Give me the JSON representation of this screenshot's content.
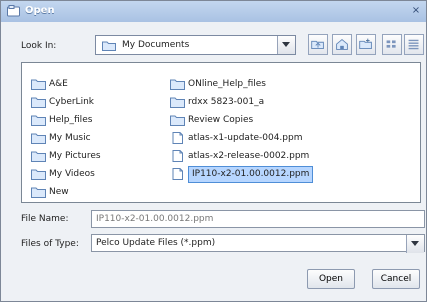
{
  "window": {
    "title": "Open",
    "close_symbol": "×"
  },
  "lookin": {
    "label": "Look In:",
    "value": "My Documents"
  },
  "toolbar": {
    "icons": [
      "up-folder-icon",
      "home-icon",
      "new-folder-icon",
      "list-view-icon",
      "details-view-icon"
    ]
  },
  "files": {
    "left": [
      "A&E",
      "CyberLink",
      "Help_files",
      "My Music",
      "My Pictures",
      "My Videos",
      "New"
    ],
    "right": [
      "ONline_Help_files",
      "rdxx 5823-001_a",
      "Review Copies",
      "atlas-x1-update-004.ppm",
      "atlas-x2-release-0002.ppm",
      "IP110-x2-01.00.0012.ppm"
    ],
    "selected": "IP110-x2-01.00.0012.ppm"
  },
  "file_name": {
    "label": "File Name:",
    "value": "IP110-x2-01.00.0012.ppm"
  },
  "file_type": {
    "label": "Files of Type:",
    "value": "Pelco Update Files (*.ppm)"
  },
  "buttons": {
    "open": "Open",
    "cancel": "Cancel"
  }
}
